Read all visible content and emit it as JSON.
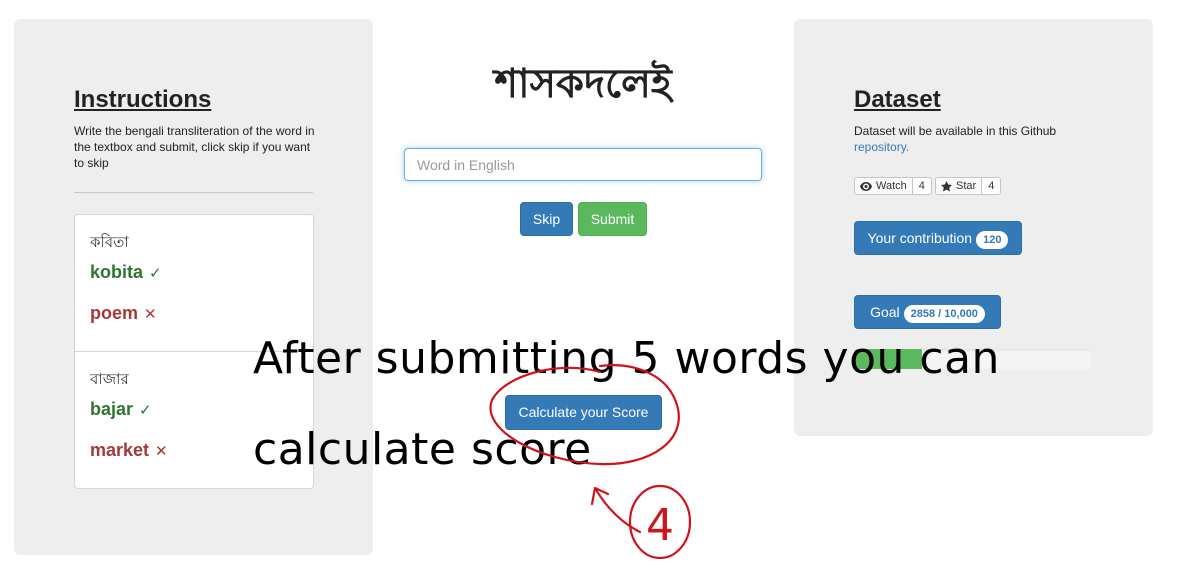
{
  "instructions": {
    "title": "Instructions",
    "description": "Write the bengali transliteration of the word in the textbox and submit, click skip if you want to skip",
    "words": [
      {
        "bengali": "কবিতা",
        "correct": "kobita",
        "correct_mark": "✓",
        "wrong": "poem",
        "wrong_mark": "✕"
      },
      {
        "bengali": "বাজার",
        "correct": "bajar",
        "correct_mark": "✓",
        "wrong": "market",
        "wrong_mark": "✕"
      }
    ]
  },
  "main": {
    "word": "শাসকদলেই",
    "input_placeholder": "Word in English",
    "skip_label": "Skip",
    "submit_label": "Submit",
    "calculate_label": "Calculate your Score"
  },
  "dataset": {
    "title": "Dataset",
    "description": "Dataset will be available in this Github",
    "link_text": "repository.",
    "watch_label": "Watch",
    "watch_count": "4",
    "star_label": "Star",
    "star_count": "4",
    "contribution_label": "Your contribution",
    "contribution_count": "120",
    "goal_label": "Goal",
    "goal_value": "2858 / 10,000",
    "goal_progress": 0.2858
  },
  "annotation": {
    "line1": "After submitting 5 words you can",
    "line2": "calculate score",
    "step_number": "4",
    "color": "#d0141c"
  },
  "colors": {
    "primary": "#337ab7",
    "success": "#5cb85c",
    "correct_text": "#2f7530",
    "wrong_text": "#a33a3a",
    "panel_bg": "#eeeeee"
  }
}
